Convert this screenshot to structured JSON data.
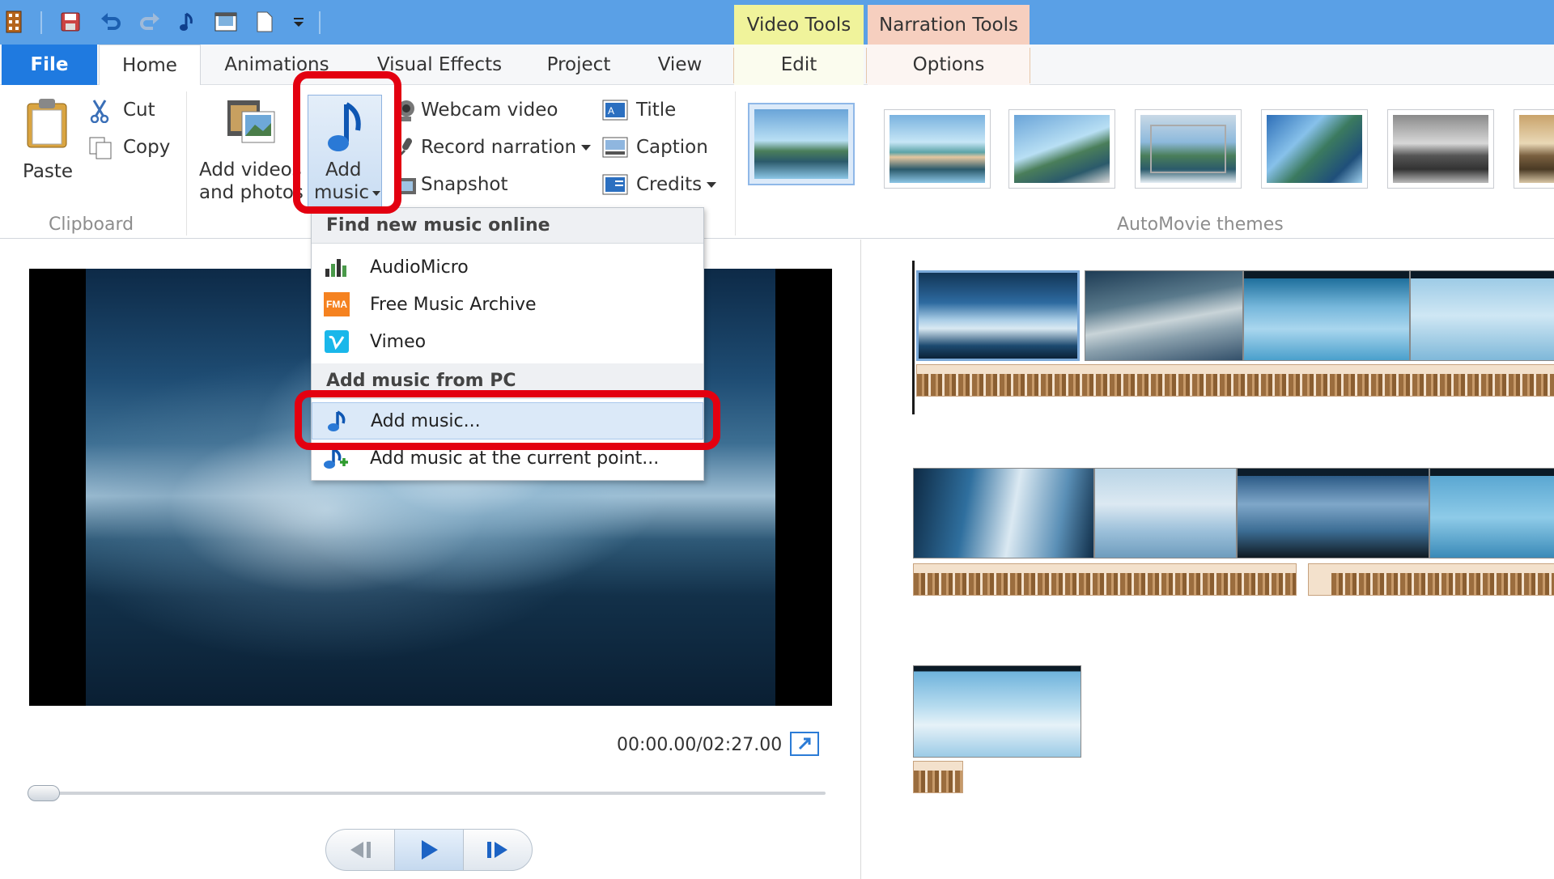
{
  "window": {
    "context_tabs": {
      "video_tools": "Video Tools",
      "narration_tools": "Narration Tools"
    }
  },
  "tabs": {
    "file": "File",
    "home": "Home",
    "animations": "Animations",
    "visual_effects": "Visual Effects",
    "project": "Project",
    "view": "View",
    "edit": "Edit",
    "options": "Options"
  },
  "ribbon": {
    "clipboard": {
      "paste": "Paste",
      "cut": "Cut",
      "copy": "Copy",
      "label": "Clipboard"
    },
    "add": {
      "add_videos_line1": "Add videos",
      "add_videos_line2": "and photos",
      "add_music_line1": "Add",
      "add_music_line2": "music",
      "webcam_video": "Webcam video",
      "record_narration": "Record narration",
      "snapshot": "Snapshot",
      "title": "Title",
      "caption": "Caption",
      "credits": "Credits"
    },
    "themes_label": "AutoMovie themes"
  },
  "music_menu": {
    "online_header": "Find new music online",
    "online_items": [
      "AudioMicro",
      "Free Music Archive",
      "Vimeo"
    ],
    "fma_badge": "FMA",
    "pc_header": "Add music from PC",
    "add_music": "Add music...",
    "add_music_current": "Add music at the current point..."
  },
  "preview": {
    "timecode": "00:00.00/02:27.00"
  },
  "colors": {
    "accent": "#1f7ae0",
    "highlight_red": "#e30010",
    "video_tools_tab": "#f0f39b",
    "narration_tools_tab": "#f6cfbf"
  },
  "icons": [
    "movie-maker-icon",
    "save-icon",
    "undo-icon",
    "redo-icon",
    "music-note-icon",
    "film-icon",
    "new-document-icon",
    "dropdown-icon",
    "paste-icon",
    "scissors-icon",
    "copy-icon",
    "add-video-icon",
    "webcam-icon",
    "microphone-icon",
    "camera-icon",
    "title-icon",
    "caption-icon",
    "credits-icon",
    "audiomicro-icon",
    "fma-icon",
    "vimeo-icon",
    "add-music-icon",
    "add-music-current-icon",
    "fullscreen-icon",
    "previous-frame-icon",
    "play-icon",
    "next-frame-icon"
  ]
}
